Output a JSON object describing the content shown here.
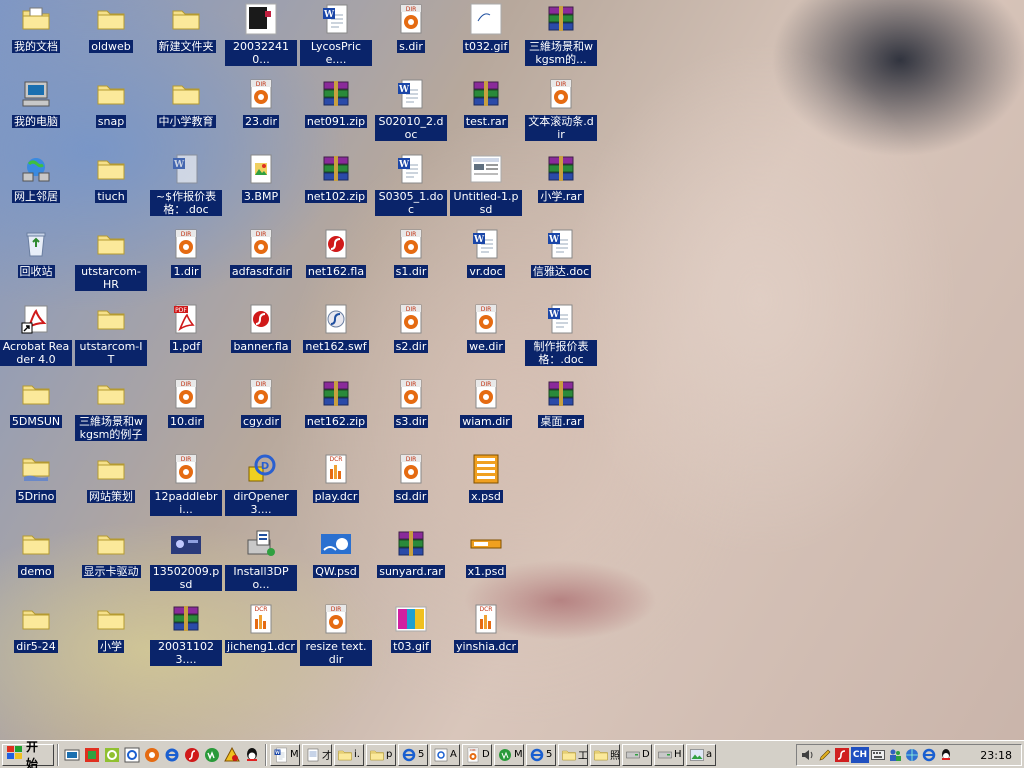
{
  "desktop": {
    "columns": [
      [
        {
          "label": "我的文档",
          "icon": "my-documents"
        },
        {
          "label": "我的电脑",
          "icon": "computer"
        },
        {
          "label": "网上邻居",
          "icon": "network"
        },
        {
          "label": "回收站",
          "icon": "recycle-bin"
        },
        {
          "label": "Acrobat Reader 4.0",
          "icon": "acrobat-shortcut"
        },
        {
          "label": "5DMSUN",
          "icon": "folder"
        },
        {
          "label": "5Drino",
          "icon": "folder-hand"
        },
        {
          "label": "demo",
          "icon": "folder"
        },
        {
          "label": "dir5-24",
          "icon": "folder"
        }
      ],
      [
        {
          "label": "oldweb",
          "icon": "folder"
        },
        {
          "label": "snap",
          "icon": "folder"
        },
        {
          "label": "tiuch",
          "icon": "folder"
        },
        {
          "label": "utstarcom-HR",
          "icon": "folder"
        },
        {
          "label": "utstarcom-IT",
          "icon": "folder"
        },
        {
          "label": "三維场景和wkgsm的例子",
          "icon": "folder"
        },
        {
          "label": "网站策划",
          "icon": "folder"
        },
        {
          "label": "显示卡驱动",
          "icon": "folder"
        },
        {
          "label": "小学",
          "icon": "folder"
        }
      ],
      [
        {
          "label": "新建文件夹",
          "icon": "folder"
        },
        {
          "label": "中小学教育",
          "icon": "folder"
        },
        {
          "label": "~$作报价表格：.doc",
          "icon": "word-ghost"
        },
        {
          "label": "1.dir",
          "icon": "director"
        },
        {
          "label": "1.pdf",
          "icon": "pdf"
        },
        {
          "label": "10.dir",
          "icon": "director"
        },
        {
          "label": "12paddlebri...",
          "icon": "director"
        },
        {
          "label": "13502009.psd",
          "icon": "image-thumb"
        },
        {
          "label": "200311023....",
          "icon": "rar"
        }
      ],
      [
        {
          "label": "200322410...",
          "icon": "image-dark"
        },
        {
          "label": "23.dir",
          "icon": "director"
        },
        {
          "label": "3.BMP",
          "icon": "bmp"
        },
        {
          "label": "adfasdf.dir",
          "icon": "director"
        },
        {
          "label": "banner.fla",
          "icon": "flash-fla"
        },
        {
          "label": "cgy.dir",
          "icon": "director"
        },
        {
          "label": "dirOpener3....",
          "icon": "installer"
        },
        {
          "label": "Install3DPo...",
          "icon": "setup"
        },
        {
          "label": "jicheng1.dcr",
          "icon": "shockwave"
        }
      ],
      [
        {
          "label": "LycosPrice....",
          "icon": "word"
        },
        {
          "label": "net091.zip",
          "icon": "rar"
        },
        {
          "label": "net102.zip",
          "icon": "rar"
        },
        {
          "label": "net162.fla",
          "icon": "flash-fla"
        },
        {
          "label": "net162.swf",
          "icon": "flash-swf"
        },
        {
          "label": "net162.zip",
          "icon": "rar"
        },
        {
          "label": "play.dcr",
          "icon": "shockwave"
        },
        {
          "label": "QW.psd",
          "icon": "image-thumb2"
        },
        {
          "label": "resize text.dir",
          "icon": "director"
        }
      ],
      [
        {
          "label": "s.dir",
          "icon": "director"
        },
        {
          "label": "S02010_2.doc",
          "icon": "word"
        },
        {
          "label": "S0305_1.doc",
          "icon": "word"
        },
        {
          "label": "s1.dir",
          "icon": "director"
        },
        {
          "label": "s2.dir",
          "icon": "director"
        },
        {
          "label": "s3.dir",
          "icon": "director"
        },
        {
          "label": "sd.dir",
          "icon": "director"
        },
        {
          "label": "sunyard.rar",
          "icon": "rar"
        },
        {
          "label": "t03.gif",
          "icon": "gif-color"
        }
      ],
      [
        {
          "label": "t032.gif",
          "icon": "gif-blank"
        },
        {
          "label": "test.rar",
          "icon": "rar"
        },
        {
          "label": "Untitled-1.psd",
          "icon": "psd-screen"
        },
        {
          "label": "vr.doc",
          "icon": "word"
        },
        {
          "label": "we.dir",
          "icon": "director"
        },
        {
          "label": "wiam.dir",
          "icon": "director"
        },
        {
          "label": "x.psd",
          "icon": "psd-orange"
        },
        {
          "label": "x1.psd",
          "icon": "psd-bar"
        },
        {
          "label": "yinshia.dcr",
          "icon": "shockwave"
        }
      ],
      [
        {
          "label": "三維场景和wkgsm的...",
          "icon": "rar"
        },
        {
          "label": "文本滚动条.dir",
          "icon": "director"
        },
        {
          "label": "小学.rar",
          "icon": "rar"
        },
        {
          "label": "信雅达.doc",
          "icon": "word"
        },
        {
          "label": "制作报价表格：.doc",
          "icon": "word"
        },
        {
          "label": "桌面.rar",
          "icon": "rar"
        }
      ]
    ]
  },
  "taskbar": {
    "start_label": "开始",
    "quick_launch": [
      "desktop-icon",
      "image-app-icon",
      "spiral-icon",
      "ie-settings-icon",
      "director-icon",
      "ie-icon",
      "flash-icon",
      "dreamweaver-icon",
      "shapes-icon",
      "qq-icon"
    ],
    "tasks": [
      {
        "label": "M",
        "icon": "word"
      },
      {
        "label": "才",
        "icon": "notepad"
      },
      {
        "label": "i.",
        "icon": "folder"
      },
      {
        "label": "p",
        "icon": "folder"
      },
      {
        "label": "5",
        "icon": "ie"
      },
      {
        "label": "A",
        "icon": "ie-settings"
      },
      {
        "label": "D",
        "icon": "director"
      },
      {
        "label": "M",
        "icon": "dreamweaver"
      },
      {
        "label": "5",
        "icon": "ie"
      },
      {
        "label": "工",
        "icon": "folder"
      },
      {
        "label": "照",
        "icon": "folder"
      },
      {
        "label": "D",
        "icon": "drive"
      },
      {
        "label": "H",
        "icon": "drive"
      },
      {
        "label": "a",
        "icon": "image-app"
      }
    ],
    "tray": {
      "ime": "CH",
      "clock": "23:18"
    }
  },
  "colors": {
    "selection": "#0a246a",
    "taskbar": "#d4d0c8",
    "folder": "#f5e08a"
  }
}
